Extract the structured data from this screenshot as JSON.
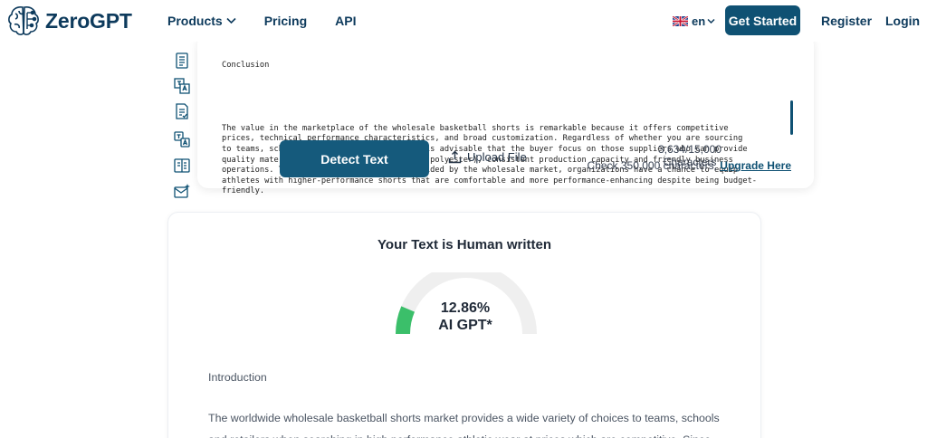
{
  "header": {
    "brand": "ZeroGPT",
    "nav": [
      {
        "label": "Products",
        "has_dropdown": true
      },
      {
        "label": "Pricing",
        "has_dropdown": false
      },
      {
        "label": "API",
        "has_dropdown": false
      }
    ],
    "language": "en",
    "get_started": "Get Started",
    "register": "Register",
    "login": "Login"
  },
  "sidebar": {
    "icons": [
      "document-icon",
      "translate-document-icon",
      "checklist-icon",
      "language-swap-icon",
      "compare-icon",
      "mail-ai-icon"
    ]
  },
  "editor": {
    "heading": "Conclusion",
    "body": "The value in the marketplace of the wholesale basketball shorts is remarkable because it offers competitive\nprices, technical performance characteristics, and broad customization. Regardless of whether you are sourcing\nto teams, schools or retail operations, it is advisable that the buyer focus on those suppliers who can provide\nquality materials (such as moisture-wicking polyester), consistent production capacity and friendly business\noperations. Through economies of scale provided by the wholesale market, organizations have a chance to equip\nathletes with higher-performance shorts that are comfortable and more performance-enhancing despite being budget-\nfriendly.",
    "detect_button": "Detect Text",
    "upload_button": "Upload File",
    "char_count": "3,634/15,000 Characters",
    "check_prefix": "Check 350,000 characters,",
    "upgrade_link": "Upgrade Here"
  },
  "result": {
    "title": "Your Text is Human written",
    "ai_percentage": 12.86,
    "percentage_text": "12.86%",
    "gauge_label": "AI GPT*",
    "gauge_color": "#3bbf6a",
    "intro_heading": "Introduction",
    "paragraph": "The worldwide wholesale basketball shorts market provides a wide variety of choices to teams, schools and retailers when searching in high performance athletic wear at prices which are competitive. Since"
  },
  "colors": {
    "brand": "#0d3a5c",
    "primary_button": "#155a7c"
  }
}
